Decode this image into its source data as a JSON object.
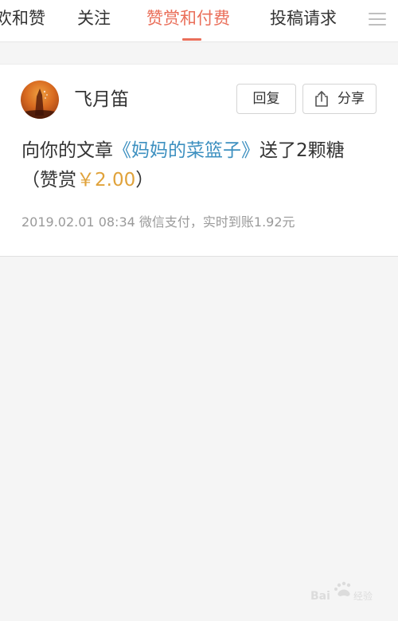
{
  "tabs": {
    "likes": "欢和赞",
    "follow": "关注",
    "reward": "赞赏和付费",
    "submit": "投稿请求"
  },
  "notification": {
    "username": "飞月笛",
    "reply_label": "回复",
    "share_label": "分享",
    "message_prefix": "向你的文章",
    "article_title": "《妈妈的菜篮子》",
    "message_suffix": "送了2颗糖（赞赏",
    "amount": "￥2.00",
    "message_end": "）",
    "meta": "2019.02.01 08:34 微信支付，实时到账1.92元"
  },
  "icons": {
    "menu": "hamburger-menu-icon",
    "share": "share-icon"
  },
  "colors": {
    "active_tab": "#ea6f5a",
    "link": "#3d90c0",
    "amount": "#e0a23a",
    "meta_text": "#9a9a9a"
  }
}
